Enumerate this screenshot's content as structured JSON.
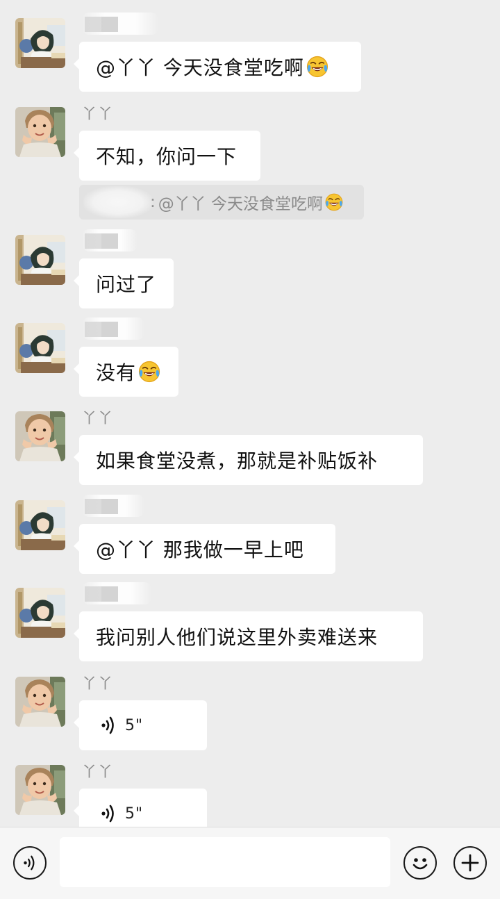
{
  "messages": [
    {
      "sender": "",
      "text": "@丫丫 今天没食堂吃啊",
      "emoji": "face-with-tears-of-joy-icon"
    },
    {
      "sender": "丫丫",
      "text": "不知，你问一下"
    },
    {
      "quote_text": "@丫丫 今天没食堂吃啊",
      "quote_prefix": ": ",
      "emoji": "face-with-tears-of-joy-icon"
    },
    {
      "sender": "",
      "text": "问过了"
    },
    {
      "sender": "",
      "text": "没有",
      "emoji": "face-with-tears-of-joy-icon"
    },
    {
      "sender": "丫丫",
      "text": "如果食堂没煮，那就是补贴饭补"
    },
    {
      "sender": "",
      "text": "@丫丫 那我做一早上吧"
    },
    {
      "sender": "",
      "text": "我问别人他们说这里外卖难送来"
    },
    {
      "sender": "丫丫",
      "voice_duration": "5\""
    },
    {
      "sender": "丫丫",
      "voice_duration": "5\""
    }
  ],
  "input": {
    "value": "",
    "voice_icon": "voice-mode-icon",
    "emoji_icon": "emoji-picker-icon",
    "more_icon": "plus-circle-icon"
  },
  "colors": {
    "background": "#ededed",
    "bubble": "#ffffff",
    "quote_background": "#e2e2e2",
    "sender_name": "#8b8b8b"
  }
}
